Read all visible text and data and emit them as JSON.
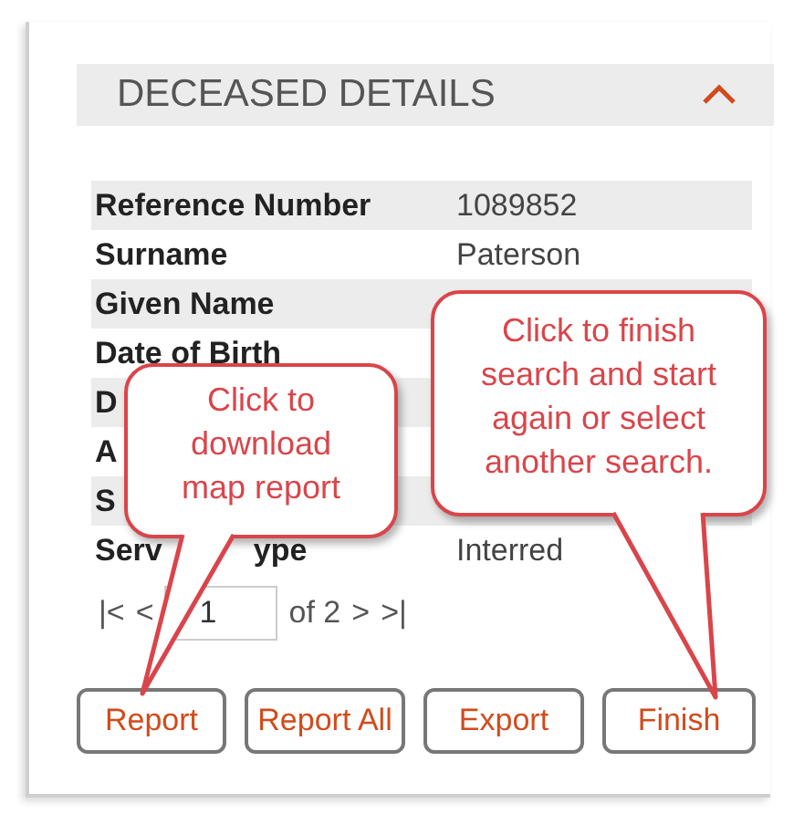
{
  "panel": {
    "title": "DECEASED DETAILS",
    "expanded": true
  },
  "rows": [
    {
      "label": "Reference Number",
      "value": "1089852"
    },
    {
      "label": "Surname",
      "value": "Paterson"
    },
    {
      "label": "Given Name"
    },
    {
      "label": "Date of Birth"
    },
    {
      "label": "D"
    },
    {
      "label": "A"
    },
    {
      "label": "S"
    },
    {
      "label": "Serv",
      "label_tail": "ype",
      "value": "Interred"
    }
  ],
  "pager": {
    "first": "|<",
    "prev": "<",
    "page": "1",
    "of": "of 2",
    "next": ">",
    "last": ">|"
  },
  "buttons": [
    "Report",
    "Report All",
    "Export",
    "Finish"
  ],
  "callouts": [
    {
      "text": "Click to download map report"
    },
    {
      "text": "Click to finish search and start again or select another search."
    }
  ]
}
